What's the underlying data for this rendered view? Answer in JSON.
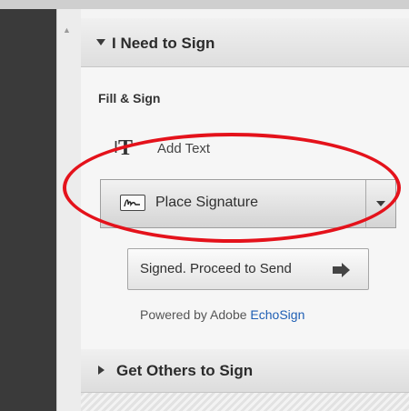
{
  "panel": {
    "sign_section": {
      "title": "I Need to Sign"
    },
    "fill_sign": {
      "heading": "Fill & Sign",
      "add_text_label": "Add Text",
      "place_signature_label": "Place Signature"
    },
    "send_button": {
      "label": "Signed. Proceed to Send"
    },
    "powered_by": {
      "prefix": "Powered by Adobe ",
      "brand": "EchoSign"
    },
    "others_section": {
      "title": "Get Others to Sign"
    }
  },
  "annotation": {
    "color": "#e4121b",
    "shape": "ellipse"
  },
  "colors": {
    "brand_link": "#1f5fb4",
    "dark_sidebar": "#3a3a3a"
  },
  "icons": [
    "chevron-up-icon",
    "caret-down-icon",
    "text-tool-icon",
    "signature-icon",
    "dropdown-arrow-icon",
    "arrow-right-icon",
    "caret-right-icon"
  ]
}
